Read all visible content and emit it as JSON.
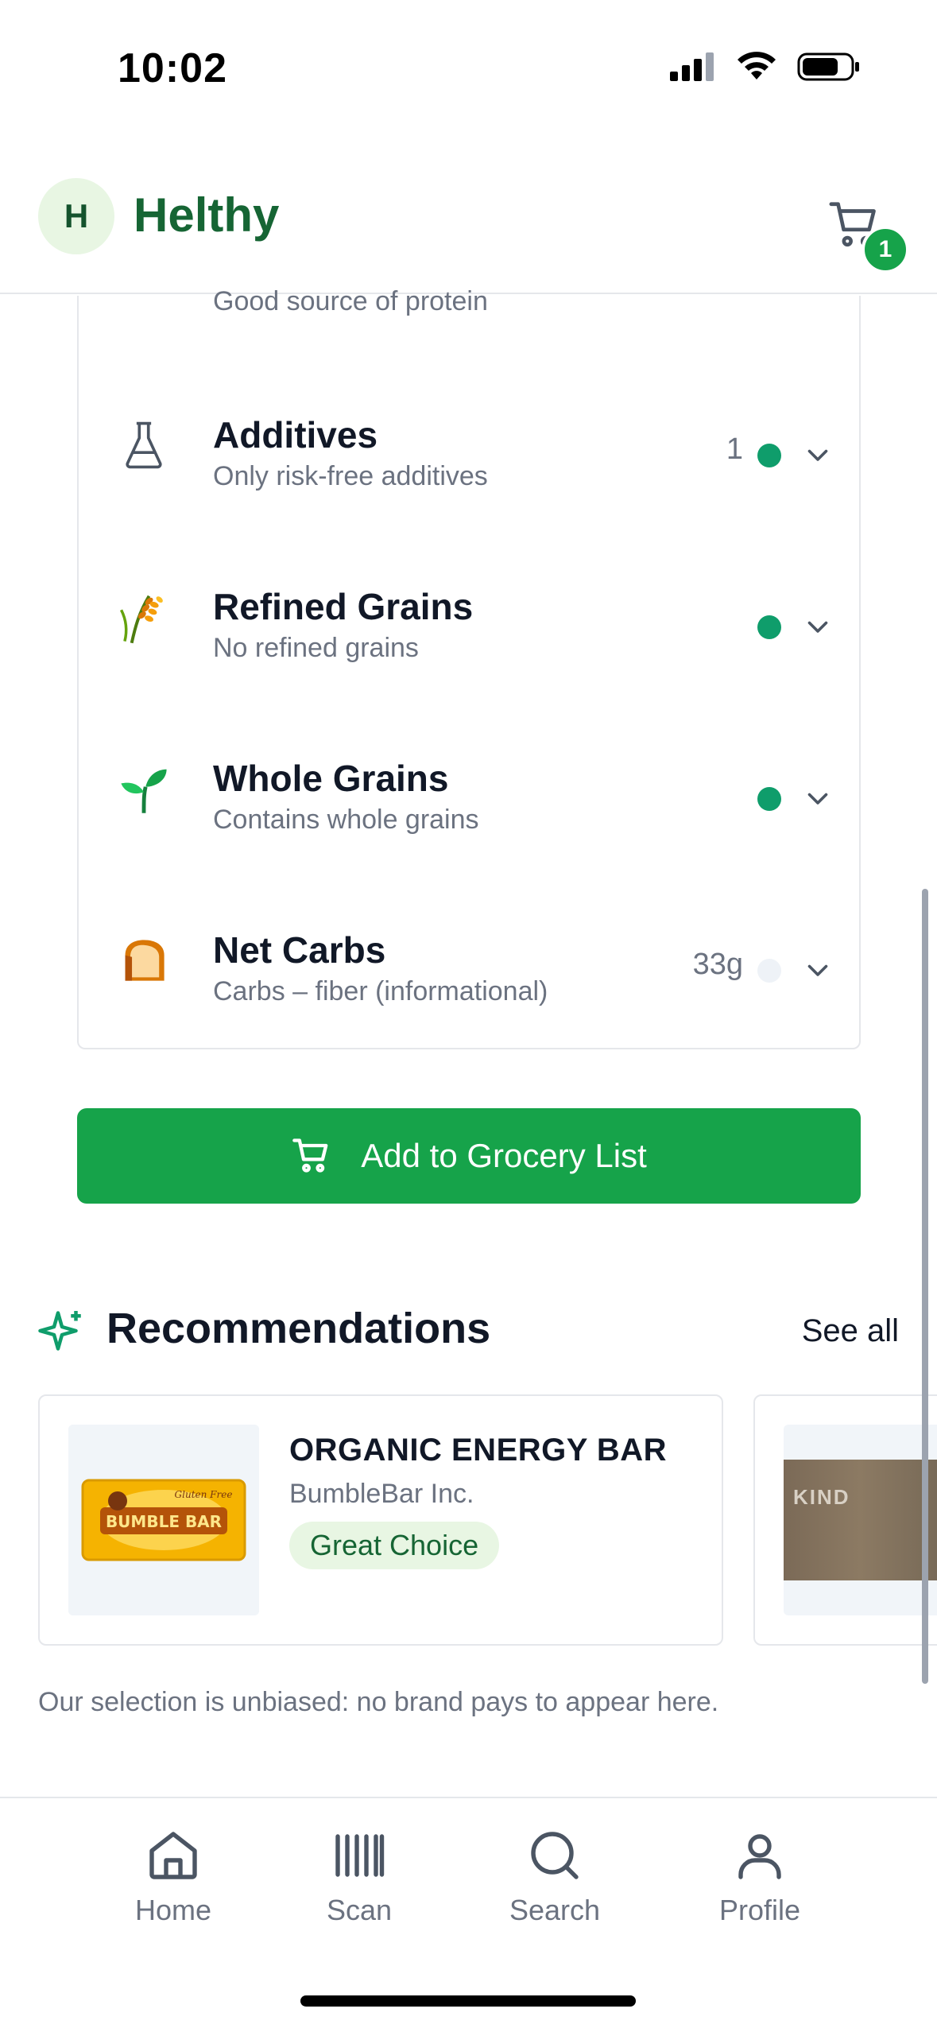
{
  "status_bar": {
    "time": "10:02"
  },
  "header": {
    "avatar_letter": "H",
    "brand": "Helthy",
    "cart_count": "1"
  },
  "nutrients": {
    "partial_subtitle": "Good source of protein",
    "rows": [
      {
        "title": "Additives",
        "subtitle": "Only risk-free additives",
        "value": "1",
        "status_color": "#0f9d6b",
        "icon": "flask-icon"
      },
      {
        "title": "Refined Grains",
        "subtitle": "No refined grains",
        "value": "",
        "status_color": "#0f9d6b",
        "icon": "wheat-icon"
      },
      {
        "title": "Whole Grains",
        "subtitle": "Contains whole grains",
        "value": "",
        "status_color": "#0f9d6b",
        "icon": "seedling-icon"
      },
      {
        "title": "Net Carbs",
        "subtitle": "Carbs – fiber (informational)",
        "value": "33g",
        "status_color": "#eef2f7",
        "icon": "bread-icon"
      }
    ]
  },
  "add_button": {
    "label": "Add to Grocery List"
  },
  "recommendations": {
    "title": "Recommendations",
    "see_all": "See all",
    "items": [
      {
        "name": "ORGANIC ENERGY BAR",
        "brand": "BumbleBar Inc.",
        "badge": "Great Choice",
        "image_text": "BUMBLE BAR"
      },
      {
        "image_text": "KIND"
      }
    ],
    "disclaimer": "Our selection is unbiased: no brand pays to appear here."
  },
  "tabs": [
    {
      "label": "Home",
      "icon": "home-icon"
    },
    {
      "label": "Scan",
      "icon": "barcode-icon"
    },
    {
      "label": "Search",
      "icon": "search-icon"
    },
    {
      "label": "Profile",
      "icon": "profile-icon"
    }
  ],
  "colors": {
    "accent": "#16a34a",
    "brand": "#166534"
  }
}
